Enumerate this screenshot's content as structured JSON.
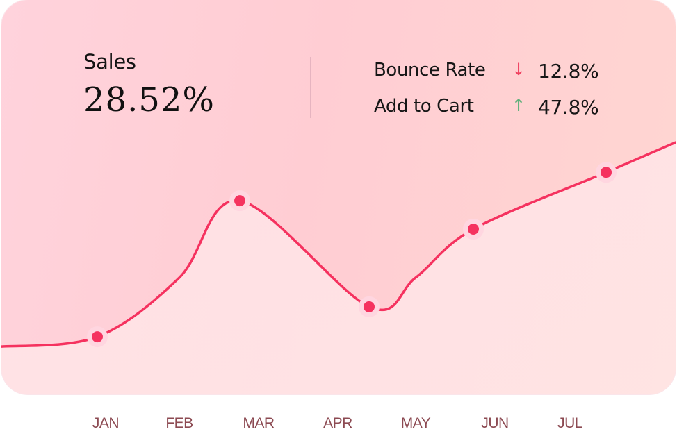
{
  "header": {
    "sales_label": "Sales",
    "sales_value": "28.52%"
  },
  "metrics": [
    {
      "label": "Bounce Rate",
      "direction": "down",
      "arrow_icon": "↓",
      "value": "12.8%",
      "color": "#f0405f"
    },
    {
      "label": "Add to Cart",
      "direction": "up",
      "arrow_icon": "↑",
      "value": "47.8%",
      "color": "#5fb07a"
    }
  ],
  "colors": {
    "line": "#f5325f",
    "point": "#f5325f",
    "point_halo": "#ffd6e0",
    "axis_label": "#8c4a52"
  },
  "chart_data": {
    "type": "line",
    "title": "Sales",
    "xlabel": "",
    "ylabel": "",
    "categories": [
      "JAN",
      "FEB",
      "MAR",
      "APR",
      "MAY",
      "JUN",
      "JUL"
    ],
    "series": [
      {
        "name": "Sales",
        "x": [
          -0.68,
          0,
          1,
          2,
          3,
          4,
          5,
          6,
          6.48
        ],
        "values": [
          12.1,
          14.6,
          29.6,
          49.1,
          22.2,
          29.6,
          41.9,
          56.3,
          63.9
        ],
        "marked_points": [
          "JAN",
          "MAR",
          "APR",
          "JUN",
          "JUL"
        ]
      }
    ],
    "ylim": [
      0,
      100
    ],
    "grid": false,
    "legend": "none",
    "axis_lines": false,
    "y_ticks_shown": false
  }
}
